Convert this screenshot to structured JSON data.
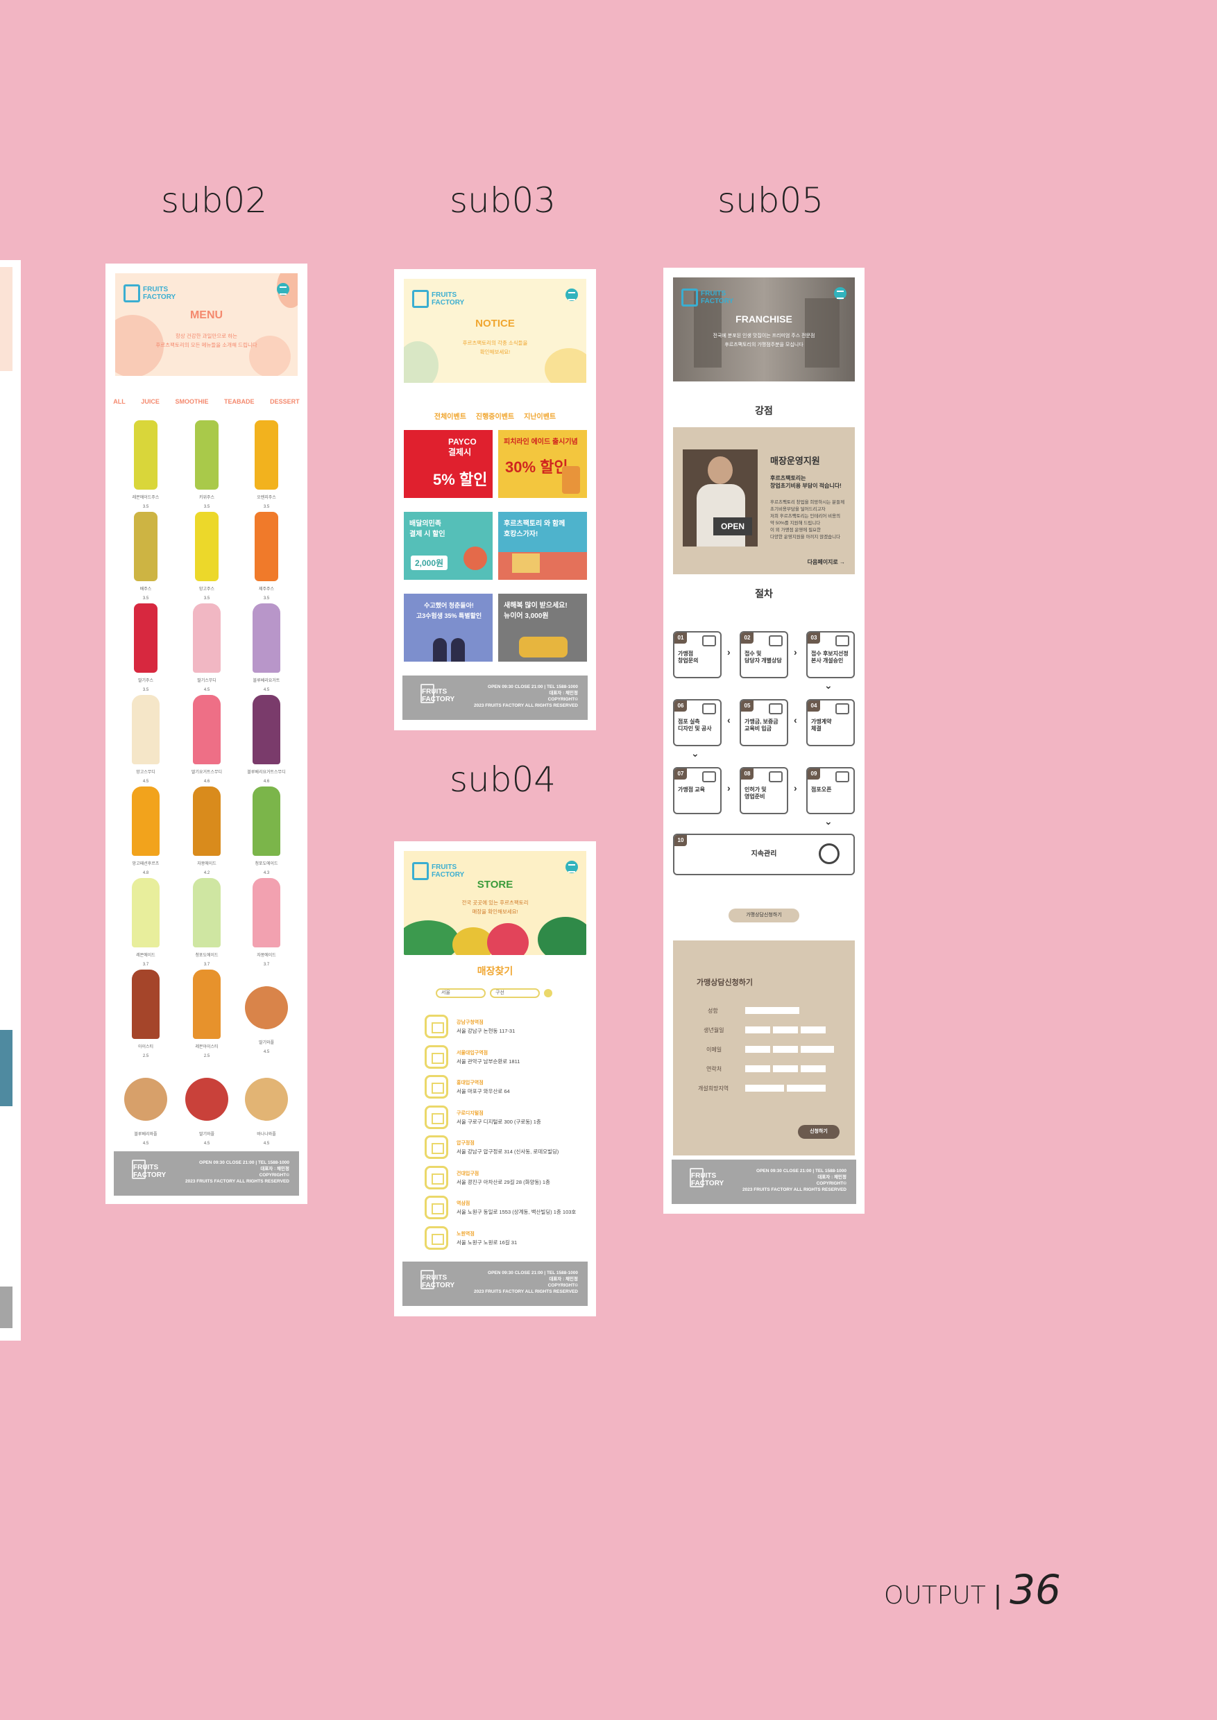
{
  "labels": {
    "sub02": "sub02",
    "sub03": "sub03",
    "sub04": "sub04",
    "sub05": "sub05"
  },
  "page_number": {
    "prefix": "OUTPUT",
    "separator": "|",
    "number": "36"
  },
  "footer": {
    "logo": "FRUITS\nFACTORY",
    "text": "OPEN 09:30 CLOSE 21:00 | TEL 1588-1000\n대표자 : 채민정\nCOPYRIGHT©\n2023 FRUITS FACTORY ALL RIGHTS RESERVED"
  },
  "sub02": {
    "header_title": "MENU",
    "header_sub": "항상 건강한 과일만으로 하는\n후르츠팩토리의 모든 메뉴들을 소개해 드립니다",
    "categories": [
      "ALL",
      "JUICE",
      "SMOOTHIE",
      "TEABADE",
      "DESSERT"
    ],
    "products": [
      {
        "name": "레몬에이드주스",
        "price": "3.5",
        "color": "#d9d63a",
        "shape": "bottle"
      },
      {
        "name": "키위주스",
        "price": "3.5",
        "color": "#a9c94a",
        "shape": "bottle"
      },
      {
        "name": "오렌지주스",
        "price": "3.5",
        "color": "#f2b21e",
        "shape": "bottle"
      },
      {
        "name": "배주스",
        "price": "3.5",
        "color": "#cdb443",
        "shape": "bottle"
      },
      {
        "name": "망고주스",
        "price": "3.5",
        "color": "#ecd82a",
        "shape": "bottle"
      },
      {
        "name": "제주주스",
        "price": "3.5",
        "color": "#f07a2a",
        "shape": "bottle"
      },
      {
        "name": "딸기주스",
        "price": "3.5",
        "color": "#d7283f",
        "shape": "bottle"
      },
      {
        "name": "딸기스무디",
        "price": "4.5",
        "color": "#f1b7c3",
        "shape": "cup"
      },
      {
        "name": "블루베리요거트",
        "price": "4.5",
        "color": "#b896c9",
        "shape": "cup"
      },
      {
        "name": "망고스무디",
        "price": "4.5",
        "color": "#f5e6c8",
        "shape": "cup"
      },
      {
        "name": "딸기요거트스무디",
        "price": "4.6",
        "color": "#ee6f86",
        "shape": "cup"
      },
      {
        "name": "블루베리요거트스무디",
        "price": "4.6",
        "color": "#7a3b6b",
        "shape": "cup"
      },
      {
        "name": "망고패션후르츠",
        "price": "4.8",
        "color": "#f2a31c",
        "shape": "cup"
      },
      {
        "name": "자몽에이드",
        "price": "4.2",
        "color": "#d98b1c",
        "shape": "cup"
      },
      {
        "name": "청포도에이드",
        "price": "4.3",
        "color": "#7bb54a",
        "shape": "cup"
      },
      {
        "name": "레몬에이드",
        "price": "3.7",
        "color": "#e8ee9c",
        "shape": "cup"
      },
      {
        "name": "청포도에이드",
        "price": "3.7",
        "color": "#cfe6a2",
        "shape": "cup"
      },
      {
        "name": "자몽에이드",
        "price": "3.7",
        "color": "#f2a1b0",
        "shape": "cup"
      },
      {
        "name": "아이스티",
        "price": "2.5",
        "color": "#a5452a",
        "shape": "cup"
      },
      {
        "name": "레몬아이스티",
        "price": "2.5",
        "color": "#e7922c",
        "shape": "cup"
      },
      {
        "name": "딸기와플",
        "price": "4.5",
        "color": "#d9844a",
        "shape": "round"
      },
      {
        "name": "블루베리와플",
        "price": "4.5",
        "color": "#d7a06a",
        "shape": "round"
      },
      {
        "name": "딸기와플",
        "price": "4.5",
        "color": "#c9413a",
        "shape": "round"
      },
      {
        "name": "바나나와플",
        "price": "4.5",
        "color": "#e2b474",
        "shape": "round"
      }
    ]
  },
  "sub03": {
    "header_title": "NOTICE",
    "header_sub": "후르츠팩토리의 각종 소식들을\n확인해보세요!",
    "tabs": [
      "전체이벤트",
      "진행중이벤트",
      "지난이벤트"
    ],
    "cards": [
      {
        "text": "PAYCO\n결제시",
        "big": "5% 할인",
        "bg": "#e0202e"
      },
      {
        "text": "피치라인 에이드 출시기념",
        "big": "30% 할인",
        "bg": "#f3c63e"
      },
      {
        "text": "배달의민족\n결제 시 할인",
        "big": "2,000원",
        "bg": "#55bfb8"
      },
      {
        "text": "후르츠팩토리 와 함께\n호캉스가자!",
        "big": "",
        "bg": "#4eb3cc"
      },
      {
        "text": "수고했어 청춘들아!\n고3수험생 35% 특별할인",
        "big": "",
        "bg": "#7d8fcd"
      },
      {
        "text": "새해복 많이 받으세요!\n뉴이어 3,000원",
        "big": "",
        "bg": "#7a7a7a"
      }
    ]
  },
  "sub04": {
    "header_title": "STORE",
    "header_sub": "전국 곳곳에 있는 후르츠팩토리\n매장을 확인해보세요!",
    "section": "매장찾기",
    "select1": "서울",
    "select2": "구선",
    "stores": [
      {
        "name": "강남구청역점",
        "addr": "서울 강남구 논현동 117-31"
      },
      {
        "name": "서울대입구역점",
        "addr": "서울 관악구 남부순환로 1811"
      },
      {
        "name": "홍대입구역점",
        "addr": "서울 마포구 와우산로 64"
      },
      {
        "name": "구로디지털점",
        "addr": "서울 구로구 디지털로 300 (구로동) 1층"
      },
      {
        "name": "압구정점",
        "addr": "서울 강남구 압구정로 314 (신사동, 로데오빌딩)"
      },
      {
        "name": "건대입구점",
        "addr": "서울 광진구 아차산로 29길 28 (화양동) 1층"
      },
      {
        "name": "역삼점",
        "addr": "서울 노원구 동일로 1553 (상계동, 백산빌딩) 1층 103호"
      },
      {
        "name": "노원역점",
        "addr": "서울 노원구 노원로 16길 31"
      }
    ]
  },
  "sub05": {
    "header_title": "FRANCHISE",
    "header_sub": "전국에 분포된 인생 맛집이는 프리미엄 주스 전문점\n후르츠팩토리의 가맹점주분을 모십니다",
    "section1": "강점",
    "strength_title": "매장운영지원",
    "strength_bold": "후르츠팩토리는\n창업초기비용 부담이 적습니다!",
    "strength_body": "후르츠팩토리 창업을 희망하시는 분들께\n초기비용부담을 덜어드리고자\n저희 후르츠팩토리는 인테리어 비용의\n약 50%를 지원해 드립니다\n이 외 가맹점 운영에 필요한\n다양한 운영지원을 아끼지 않겠습니다",
    "strength_link": "다음페이지로 →",
    "open_sign": "OPEN",
    "section2": "절차",
    "steps": [
      {
        "no": "01",
        "label": "가맹점\n창업문의"
      },
      {
        "no": "02",
        "label": "접수 및\n담당자 개별상담"
      },
      {
        "no": "03",
        "label": "접수 후보지선정\n본사 개설승인"
      },
      {
        "no": "06",
        "label": "점포 실측\n디자인 및 공사"
      },
      {
        "no": "05",
        "label": "가맹금, 보증금\n교육비 입금"
      },
      {
        "no": "04",
        "label": "가맹계약\n체결"
      },
      {
        "no": "07",
        "label": "가맹점 교육"
      },
      {
        "no": "08",
        "label": "인허가 및\n영업준비"
      },
      {
        "no": "09",
        "label": "점포오픈"
      }
    ],
    "step10": {
      "no": "10",
      "label": "지속관리"
    },
    "apply_button": "가맹상담신청하기",
    "form_title": "가맹상담신청하기",
    "form_fields": [
      "성함",
      "생년월일",
      "이메일",
      "연락처",
      "개설희망지역"
    ],
    "form_submit": "신청하기"
  },
  "colors": {
    "background": "#f2b5c3",
    "menu_title": "#f4896e",
    "notice_title": "#f0a630",
    "store_title": "#3a9b3a",
    "franchise_panel": "#d7c8b2"
  }
}
